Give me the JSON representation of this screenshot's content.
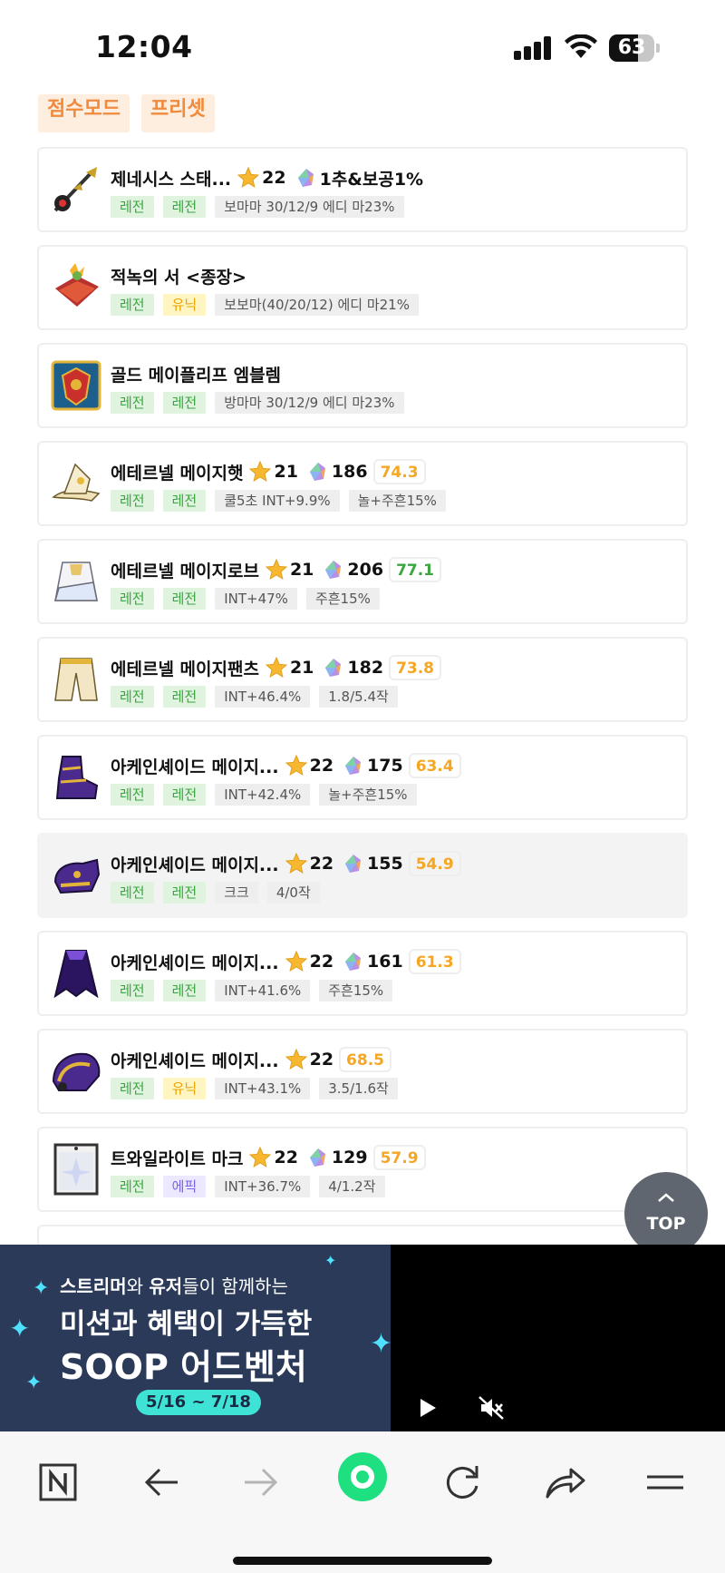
{
  "status_bar": {
    "time": "12:04",
    "battery": "63",
    "battery_level": 0.63
  },
  "mode_tabs": [
    "점수모드",
    "프리셋"
  ],
  "colors": {
    "accent_orange": "#f08a3c",
    "legend_green": "#3aa641",
    "unique_yellow": "#e8a300",
    "epic_purple": "#7b63e6",
    "score_orange": "#f5a623",
    "reload_green": "#1ee080"
  },
  "items": [
    {
      "icon": "genesis-staff-icon",
      "name": "제네시스 스태...",
      "stars": "22",
      "potential": "1추&보공1%",
      "score": "",
      "score_color": "",
      "tags": [
        {
          "text": "레전",
          "type": "legend"
        },
        {
          "text": "레전",
          "type": "legend"
        }
      ],
      "opts": [
        "보마마 30/12/9 에디 마23%"
      ]
    },
    {
      "icon": "red-book-icon",
      "name": "적녹의 서 <종장>",
      "stars": "",
      "potential": "",
      "score": "",
      "score_color": "",
      "tags": [
        {
          "text": "레전",
          "type": "legend"
        },
        {
          "text": "유닉",
          "type": "unique"
        }
      ],
      "opts": [
        "보보마(40/20/12) 에디 마21%"
      ]
    },
    {
      "icon": "emblem-icon",
      "name": "골드 메이플리프 엠블렘",
      "stars": "",
      "potential": "",
      "score": "",
      "score_color": "",
      "tags": [
        {
          "text": "레전",
          "type": "legend"
        },
        {
          "text": "레전",
          "type": "legend"
        }
      ],
      "opts": [
        "방마마 30/12/9 에디 마23%"
      ]
    },
    {
      "icon": "mage-hat-icon",
      "name": "에테르넬 메이지햇",
      "stars": "21",
      "potential": "186",
      "score": "74.3",
      "score_color": "orange",
      "tags": [
        {
          "text": "레전",
          "type": "legend"
        },
        {
          "text": "레전",
          "type": "legend"
        }
      ],
      "opts": [
        "쿨5초 INT+9.9%",
        "놀+주흔15%"
      ]
    },
    {
      "icon": "mage-robe-icon",
      "name": "에테르넬 메이지로브",
      "stars": "21",
      "potential": "206",
      "score": "77.1",
      "score_color": "green",
      "tags": [
        {
          "text": "레전",
          "type": "legend"
        },
        {
          "text": "레전",
          "type": "legend"
        }
      ],
      "opts": [
        "INT+47%",
        "주흔15%"
      ]
    },
    {
      "icon": "mage-pants-icon",
      "name": "에테르넬 메이지팬츠",
      "stars": "21",
      "potential": "182",
      "score": "73.8",
      "score_color": "orange",
      "tags": [
        {
          "text": "레전",
          "type": "legend"
        },
        {
          "text": "레전",
          "type": "legend"
        }
      ],
      "opts": [
        "INT+46.4%",
        "1.8/5.4작"
      ]
    },
    {
      "icon": "arcane-shoes-icon",
      "name": "아케인셰이드 메이지...",
      "stars": "22",
      "potential": "175",
      "score": "63.4",
      "score_color": "orange",
      "tags": [
        {
          "text": "레전",
          "type": "legend"
        },
        {
          "text": "레전",
          "type": "legend"
        }
      ],
      "opts": [
        "INT+42.4%",
        "놀+주흔15%"
      ]
    },
    {
      "icon": "arcane-gloves-icon",
      "name": "아케인셰이드 메이지...",
      "stars": "22",
      "potential": "155",
      "score": "54.9",
      "score_color": "orange",
      "tags": [
        {
          "text": "레전",
          "type": "legend"
        },
        {
          "text": "레전",
          "type": "legend"
        }
      ],
      "opts": [
        "크크",
        "4/0작"
      ]
    },
    {
      "icon": "arcane-cape-icon",
      "name": "아케인셰이드 메이지...",
      "stars": "22",
      "potential": "161",
      "score": "61.3",
      "score_color": "orange",
      "tags": [
        {
          "text": "레전",
          "type": "legend"
        },
        {
          "text": "레전",
          "type": "legend"
        }
      ],
      "opts": [
        "INT+41.6%",
        "주흔15%"
      ]
    },
    {
      "icon": "arcane-shoulder-icon",
      "name": "아케인셰이드 메이지...",
      "stars": "22",
      "potential": "",
      "score": "68.5",
      "score_color": "orange",
      "tags": [
        {
          "text": "레전",
          "type": "legend"
        },
        {
          "text": "유닉",
          "type": "unique"
        }
      ],
      "opts": [
        "INT+43.1%",
        "3.5/1.6작"
      ]
    },
    {
      "icon": "twilight-mark-icon",
      "name": "트와일라이트 마크",
      "stars": "22",
      "potential": "129",
      "score": "57.9",
      "score_color": "orange",
      "tags": [
        {
          "text": "레전",
          "type": "legend"
        },
        {
          "text": "에픽",
          "type": "epic"
        }
      ],
      "opts": [
        "INT+36.7%",
        "4/1.2작"
      ]
    }
  ],
  "top_button": {
    "label": "TOP"
  },
  "ad": {
    "line1_a": "스트리머",
    "line1_b": "와 ",
    "line1_c": "유저",
    "line1_d": "들이 함께하는",
    "line2": "미션과 혜택이 가득한",
    "line3": "SOOP 어드벤처",
    "date": "5/16 ~ 7/18"
  },
  "bottom_nav": [
    "naver-n-icon",
    "back-arrow-icon",
    "forward-arrow-icon",
    "green-home-icon",
    "reload-icon",
    "share-icon",
    "menu-icon"
  ]
}
